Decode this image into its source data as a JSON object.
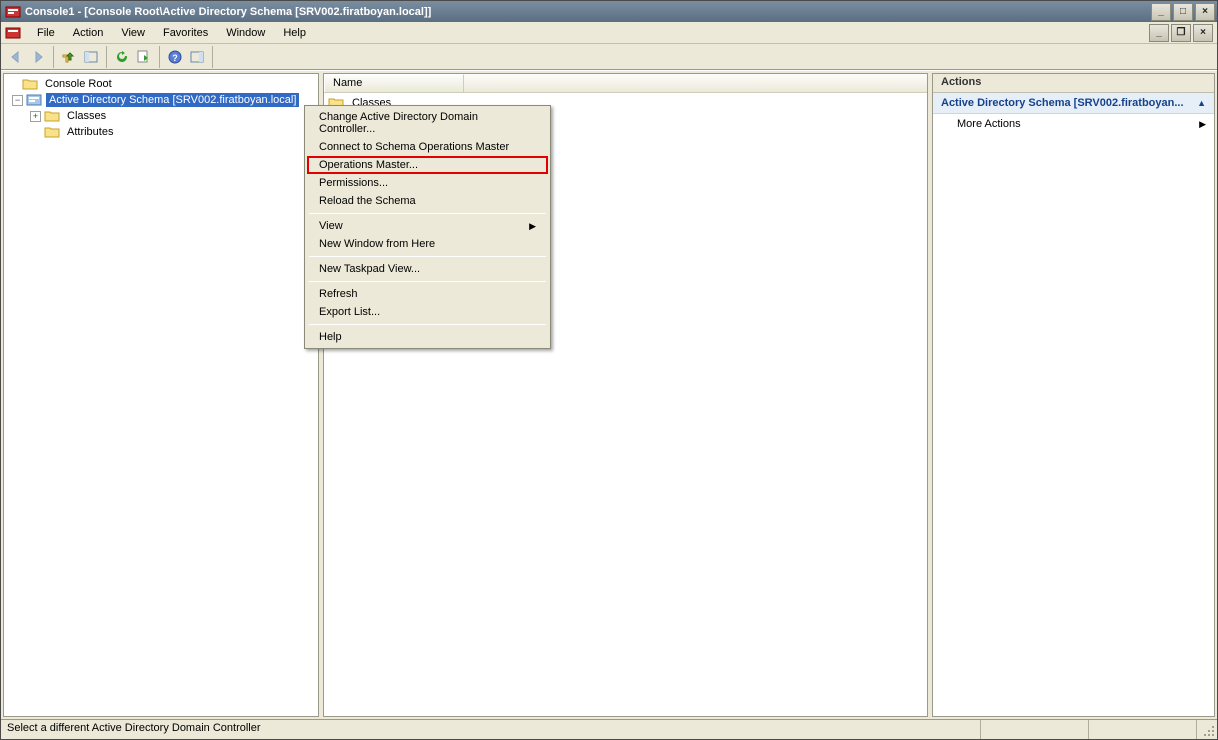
{
  "window": {
    "title": "Console1 - [Console Root\\Active Directory Schema [SRV002.firatboyan.local]]"
  },
  "mdi": {
    "tooltip": ""
  },
  "menus": {
    "file": "File",
    "action": "Action",
    "view": "View",
    "favorites": "Favorites",
    "window": "Window",
    "help": "Help"
  },
  "tree": {
    "root": "Console Root",
    "schema": "Active Directory Schema [SRV002.firatboyan.local]",
    "classes": "Classes",
    "attributes": "Attributes"
  },
  "list": {
    "col_name": "Name",
    "row_classes": "Classes"
  },
  "actions": {
    "header": "Actions",
    "group_title": "Active Directory Schema [SRV002.firatboyan...",
    "more_actions": "More Actions"
  },
  "context_menu": {
    "change_dc": "Change Active Directory Domain Controller...",
    "connect_som": "Connect to Schema Operations Master",
    "operations_master": "Operations Master...",
    "permissions": "Permissions...",
    "reload_schema": "Reload the Schema",
    "view": "View",
    "new_window": "New Window from Here",
    "new_taskpad": "New Taskpad View...",
    "refresh": "Refresh",
    "export_list": "Export List...",
    "help": "Help"
  },
  "status": {
    "text": "Select a different Active Directory Domain Controller"
  }
}
